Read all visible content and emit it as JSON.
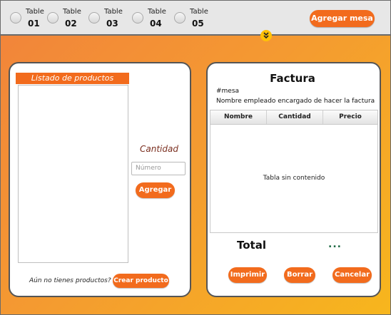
{
  "header": {
    "tables": [
      {
        "label": "Table",
        "number": "01"
      },
      {
        "label": "Table",
        "number": "02"
      },
      {
        "label": "Table",
        "number": "03"
      },
      {
        "label": "Table",
        "number": "04"
      },
      {
        "label": "Table",
        "number": "05"
      }
    ],
    "add_table_label": "Agregar mesa",
    "expand_icon": "double-chevron-down-icon"
  },
  "products": {
    "title": "Listado de productos",
    "quantity_label": "Cantidad",
    "quantity_placeholder": "Número",
    "add_label": "Agregar",
    "no_products_text": "Aún no tienes productos?",
    "create_label": "Crear producto"
  },
  "invoice": {
    "title": "Factura",
    "table_field": "#mesa",
    "employee_field": "Nombre empleado encargado de hacer la factura",
    "columns": [
      "Nombre",
      "Cantidad",
      "Precio"
    ],
    "empty_text": "Tabla sin contenido",
    "total_label": "Total",
    "total_value": "...",
    "print_label": "Imprimir",
    "clear_label": "Borrar",
    "cancel_label": "Cancelar"
  },
  "colors": {
    "accent": "#f26b1d",
    "gradient_start": "#f2853a",
    "gradient_end": "#f7b61d",
    "chevron": "#ffc107"
  }
}
